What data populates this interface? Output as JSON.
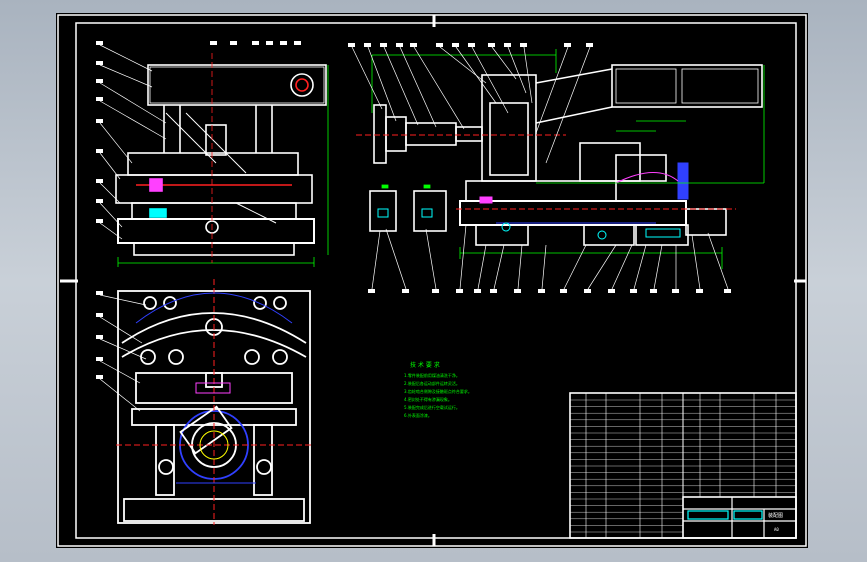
{
  "drawing": {
    "tech_req_title": "技 术 要 求",
    "tech_req_lines": [
      "1.零件装配前用煤油清洗干净。",
      "2.装配后各运动部件运转灵活。",
      "3.齿轮啮合侧隙及接触斑点符合要求。",
      "4.密封处不得有渗漏现象。",
      "5.装配完成后进行空载试运行。",
      "6.外表面涂漆。"
    ],
    "title_block": {
      "name": "装配图",
      "sheet": "A0"
    }
  },
  "colors": {
    "background": "#000000",
    "frame": "#ffffff",
    "green": "#00ff00",
    "red": "#ff2020",
    "cyan": "#00ffff",
    "blue": "#3040ff",
    "magenta": "#ff40ff",
    "yellow": "#ffff00"
  }
}
